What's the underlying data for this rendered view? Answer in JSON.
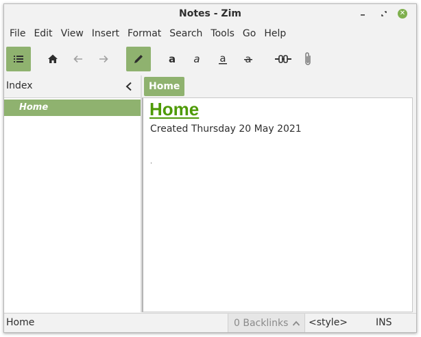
{
  "window": {
    "title": "Notes - Zim",
    "controls": {
      "minimize_icon": "minimize-icon",
      "maximize_icon": "maximize-icon",
      "close_icon": "close-icon",
      "close_glyph": "✕"
    }
  },
  "menubar": {
    "items": [
      "File",
      "Edit",
      "View",
      "Insert",
      "Format",
      "Search",
      "Tools",
      "Go",
      "Help"
    ]
  },
  "toolbar": {
    "buttons": [
      {
        "icon": "index-list-icon",
        "active": true
      },
      {
        "icon": "home-icon",
        "active": false
      },
      {
        "icon": "arrow-back-icon",
        "active": false
      },
      {
        "icon": "arrow-forward-icon",
        "active": false
      },
      {
        "icon": "pencil-edit-icon",
        "active": true
      },
      {
        "icon": "bold-icon",
        "glyph": "a"
      },
      {
        "icon": "italic-icon",
        "glyph": "a"
      },
      {
        "icon": "underline-icon",
        "glyph": "a"
      },
      {
        "icon": "strikethrough-icon",
        "glyph": "a"
      },
      {
        "icon": "link-icon"
      },
      {
        "icon": "attachment-icon"
      }
    ]
  },
  "index_pane": {
    "header": "Index",
    "collapse_icon": "chevron-left-icon",
    "items": [
      {
        "label": "Home",
        "selected": true
      }
    ]
  },
  "pathbar": {
    "crumbs": [
      "Home"
    ]
  },
  "editor": {
    "heading": "Home",
    "body": "Created Thursday 20 May 2021"
  },
  "statusbar": {
    "page": "Home",
    "backlinks": "0 Backlinks",
    "backlinks_icon": "chevron-up-icon",
    "style": "<style>",
    "mode": "INS"
  },
  "colors": {
    "accent": "#8fb26f",
    "heading": "#4e9a06",
    "close_button": "#7fb04e",
    "window_bg": "#f2f2f2"
  }
}
